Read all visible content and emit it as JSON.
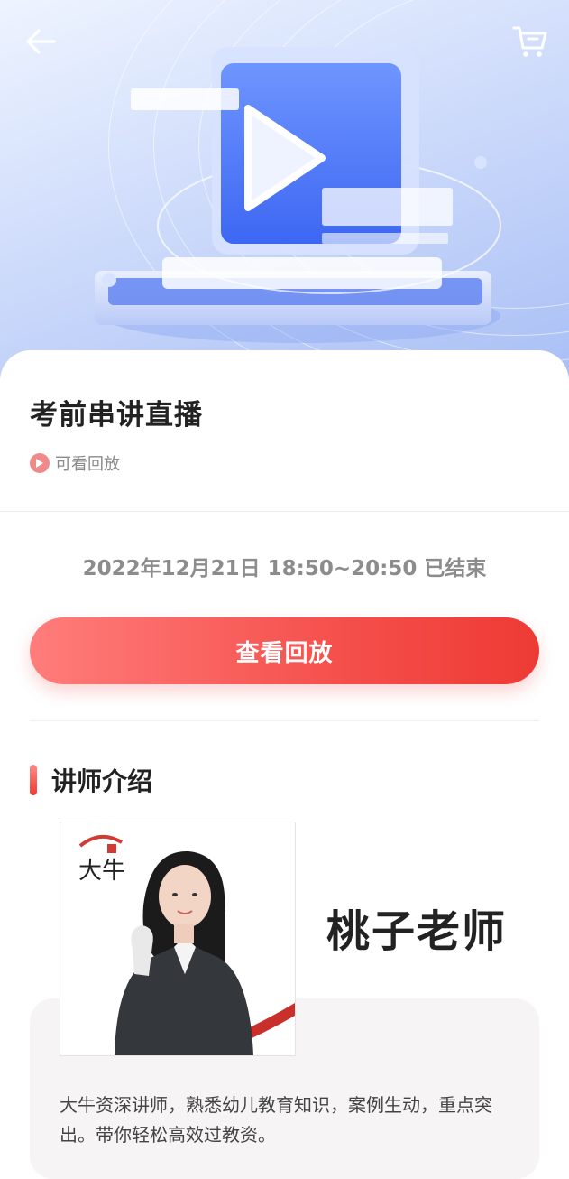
{
  "nav": {
    "back_icon": "arrow-left-icon",
    "cart_icon": "shopping-cart-icon"
  },
  "hero": {
    "illustration": "video-play-icon"
  },
  "course": {
    "title": "考前串讲直播",
    "replay_tag": "可看回放",
    "schedule": "2022年12月21日 18:50~20:50 已结束",
    "replay_button": "查看回放"
  },
  "teacher_section": {
    "heading": "讲师介绍",
    "name": "桃子老师",
    "logo_text": "大牛",
    "description": "大牛资深讲师，熟悉幼儿教育知识，案例生动，重点突出。带你轻松高效过教资。"
  },
  "colors": {
    "accent": "#ee3a34",
    "accent_light": "#ff7d7b",
    "hero_blue": "#a9bff5"
  }
}
